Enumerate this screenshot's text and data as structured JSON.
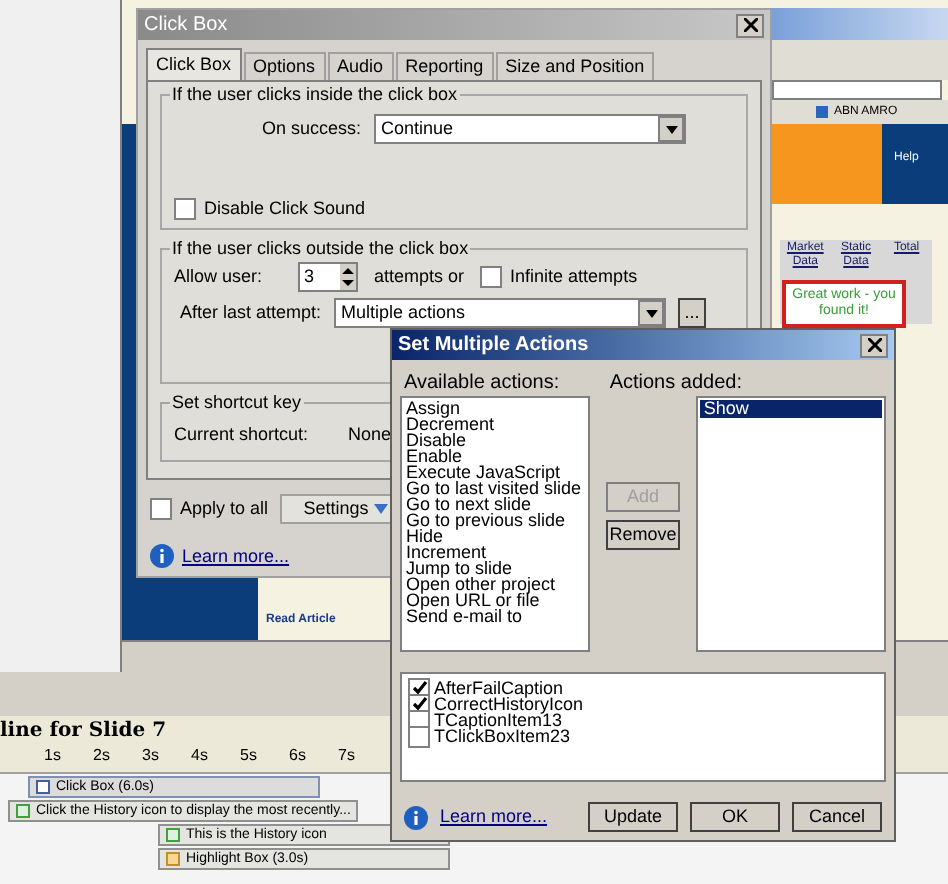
{
  "click_box_dialog": {
    "title": "Click Box",
    "tabs": [
      {
        "label": "Click Box",
        "selected": true
      },
      {
        "label": "Options",
        "selected": false
      },
      {
        "label": "Audio",
        "selected": false
      },
      {
        "label": "Reporting",
        "selected": false
      },
      {
        "label": "Size and Position",
        "selected": false
      }
    ],
    "inside_group": {
      "legend": "If the user clicks inside the click box",
      "on_success_label": "On success:",
      "on_success_value": "Continue",
      "disable_sound": {
        "label": "Disable Click Sound",
        "checked": false
      }
    },
    "outside_group": {
      "legend": "If the user clicks outside the click box",
      "allow_user_label": "Allow user:",
      "attempts_value": "3",
      "attempts_suffix": "attempts or",
      "infinite": {
        "label": "Infinite attempts",
        "checked": false
      },
      "after_last_label": "After last attempt:",
      "after_last_value": "Multiple actions",
      "more_button": "..."
    },
    "shortcut_group": {
      "legend": "Set shortcut key",
      "current_label": "Current shortcut:",
      "current_value": "None"
    },
    "apply_all": {
      "label": "Apply to all",
      "checked": false
    },
    "settings_button": "Settings",
    "learn_more": "Learn more..."
  },
  "background_page": {
    "links_bar": "ABN AMRO",
    "help": "Help",
    "table_columns": [
      "Market Data",
      "Static Data",
      "Total"
    ],
    "callout": "Great work - you found it!",
    "article_link": "Read Article"
  },
  "multiple_actions_dialog": {
    "title": "Set Multiple Actions",
    "available_label": "Available actions:",
    "added_label": "Actions added:",
    "available_actions": [
      "Assign",
      "Decrement",
      "Disable",
      "Enable",
      "Execute JavaScript",
      "Go to last visited slide",
      "Go to next slide",
      "Go to previous slide",
      "Hide",
      "Increment",
      "Jump to slide",
      "Open other project",
      "Open URL or file",
      "Send e-mail to"
    ],
    "add_button": {
      "label": "Add",
      "disabled": true
    },
    "remove_button": {
      "label": "Remove",
      "disabled": false
    },
    "added_actions": [
      {
        "label": "Show",
        "selected": true
      }
    ],
    "items": [
      {
        "label": "AfterFailCaption",
        "checked": true
      },
      {
        "label": "CorrectHistoryIcon",
        "checked": true
      },
      {
        "label": "TCaptionItem13",
        "checked": false
      },
      {
        "label": "TClickBoxItem23",
        "checked": false
      }
    ],
    "learn_more": "Learn more...",
    "buttons": [
      "Update",
      "OK",
      "Cancel"
    ]
  },
  "timeline": {
    "title": "line for Slide 7",
    "ticks": [
      "1s",
      "2s",
      "3s",
      "4s",
      "5s",
      "6s",
      "7s"
    ],
    "rows": [
      {
        "label": "Click Box (6.0s)",
        "kind": "clickbox"
      },
      {
        "label": "Click the History icon to display the most recently...",
        "kind": "caption"
      },
      {
        "label": "This is the History icon",
        "kind": "caption"
      },
      {
        "label": "Highlight Box (3.0s)",
        "kind": "highlight"
      }
    ]
  }
}
